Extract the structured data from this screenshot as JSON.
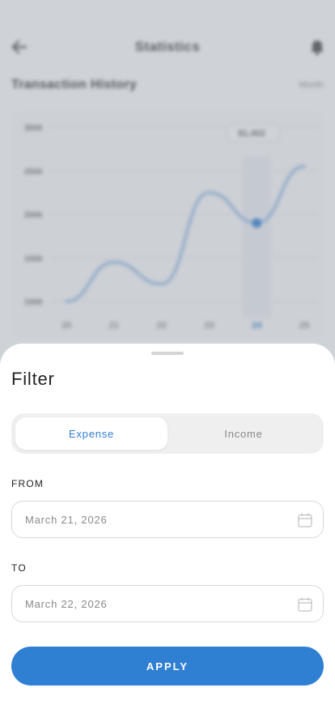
{
  "background": {
    "title": "Statistics",
    "subtitle": "Transaction History",
    "range": "Month",
    "back_icon": "arrow-left-icon",
    "bell_icon": "bell-icon",
    "tooltip": "$1,402",
    "chart_data": {
      "type": "line",
      "x": [
        "20",
        "21",
        "22",
        "23",
        "24",
        "25"
      ],
      "y_ticks": [
        "3000",
        "2500",
        "2000",
        "1500",
        "1000"
      ],
      "highlighted_x": "24",
      "series": [
        {
          "values": [
            1000,
            1450,
            1200,
            2250,
            1900,
            2550
          ]
        }
      ],
      "ylim": [
        1000,
        3000
      ]
    }
  },
  "filter": {
    "title": "Filter",
    "tabs": [
      {
        "label": "Expense",
        "active": true
      },
      {
        "label": "Income",
        "active": false
      }
    ],
    "from": {
      "label": "FROM",
      "value": "March 21, 2026",
      "icon": "calendar-icon"
    },
    "to": {
      "label": "TO",
      "value": "March 22, 2026",
      "icon": "calendar-icon"
    },
    "apply_label": "APPLY"
  },
  "colors": {
    "accent": "#2f7fd3",
    "overlay": "#8c94a0",
    "inactive_text": "#8a8a8a"
  }
}
